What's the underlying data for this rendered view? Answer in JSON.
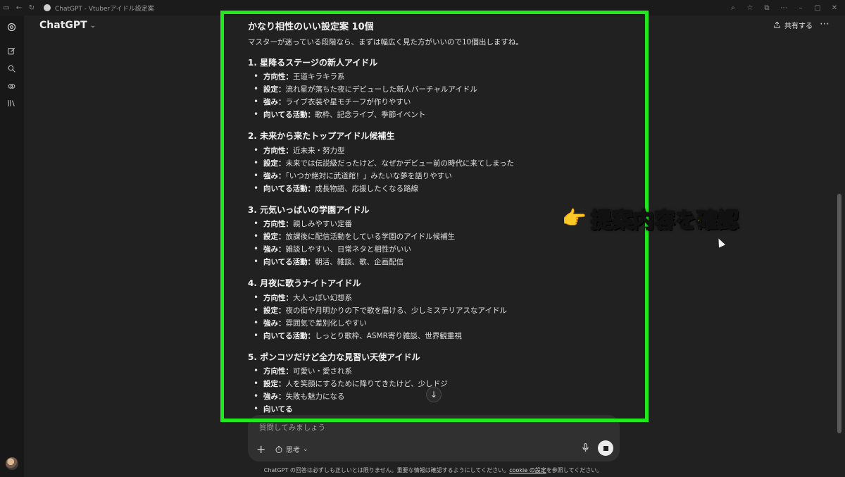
{
  "browser": {
    "tab_title": "ChatGPT - Vtuberアイドル設定案"
  },
  "header": {
    "app_name": "ChatGPT",
    "share_label": "共有する"
  },
  "response": {
    "heading": "かなり相性のいい設定案 10個",
    "intro": "マスターが迷っている段階なら、まずは幅広く見た方がいいので10個出しますね。",
    "sections": [
      {
        "title": "1. 星降るステージの新人アイドル",
        "items": [
          {
            "label": "方向性：",
            "text": "王道キラキラ系"
          },
          {
            "label": "設定：",
            "text": "流れ星が落ちた夜にデビューした新人バーチャルアイドル"
          },
          {
            "label": "強み：",
            "text": "ライブ衣装や星モチーフが作りやすい"
          },
          {
            "label": "向いてる活動：",
            "text": "歌枠、記念ライブ、季節イベント"
          }
        ]
      },
      {
        "title": "2. 未来から来たトップアイドル候補生",
        "items": [
          {
            "label": "方向性：",
            "text": "近未来・努力型"
          },
          {
            "label": "設定：",
            "text": "未来では伝説級だったけど、なぜかデビュー前の時代に来てしまった"
          },
          {
            "label": "強み：",
            "text": "「いつか絶対に武道館！」みたいな夢を語りやすい"
          },
          {
            "label": "向いてる活動：",
            "text": "成長物語、応援したくなる路線"
          }
        ]
      },
      {
        "title": "3. 元気いっぱいの学園アイドル",
        "items": [
          {
            "label": "方向性：",
            "text": "親しみやすい定番"
          },
          {
            "label": "設定：",
            "text": "放課後に配信活動をしている学園のアイドル候補生"
          },
          {
            "label": "強み：",
            "text": "雑談しやすい、日常ネタと相性がいい"
          },
          {
            "label": "向いてる活動：",
            "text": "朝活、雑談、歌、企画配信"
          }
        ]
      },
      {
        "title": "4. 月夜に歌うナイトアイドル",
        "items": [
          {
            "label": "方向性：",
            "text": "大人っぽい幻想系"
          },
          {
            "label": "設定：",
            "text": "夜の街や月明かりの下で歌を届ける、少しミステリアスなアイドル"
          },
          {
            "label": "強み：",
            "text": "雰囲気で差別化しやすい"
          },
          {
            "label": "向いてる活動：",
            "text": "しっとり歌枠、ASMR寄り雑談、世界観重視"
          }
        ]
      },
      {
        "title": "5. ポンコツだけど全力な見習い天使アイドル",
        "items": [
          {
            "label": "方向性：",
            "text": "可愛い・愛され系"
          },
          {
            "label": "設定：",
            "text": "人を笑顔にするために降りてきたけど、少しドジ"
          },
          {
            "label": "強み：",
            "text": "失敗も魅力になる"
          },
          {
            "label": "向いてる",
            "text": ""
          }
        ]
      }
    ]
  },
  "composer": {
    "placeholder": "質問してみましょう",
    "mode_label": "思考"
  },
  "footer": {
    "before": "ChatGPT の回答は必ずしも正しいとは限りません。重要な情報は確認するようにしてください。",
    "link": "cookie の設定",
    "after": "を参照してください。"
  },
  "annotation": {
    "text": "提案内容を確認",
    "highlight_color": "#22e81e",
    "text_color": "#ffe600"
  }
}
